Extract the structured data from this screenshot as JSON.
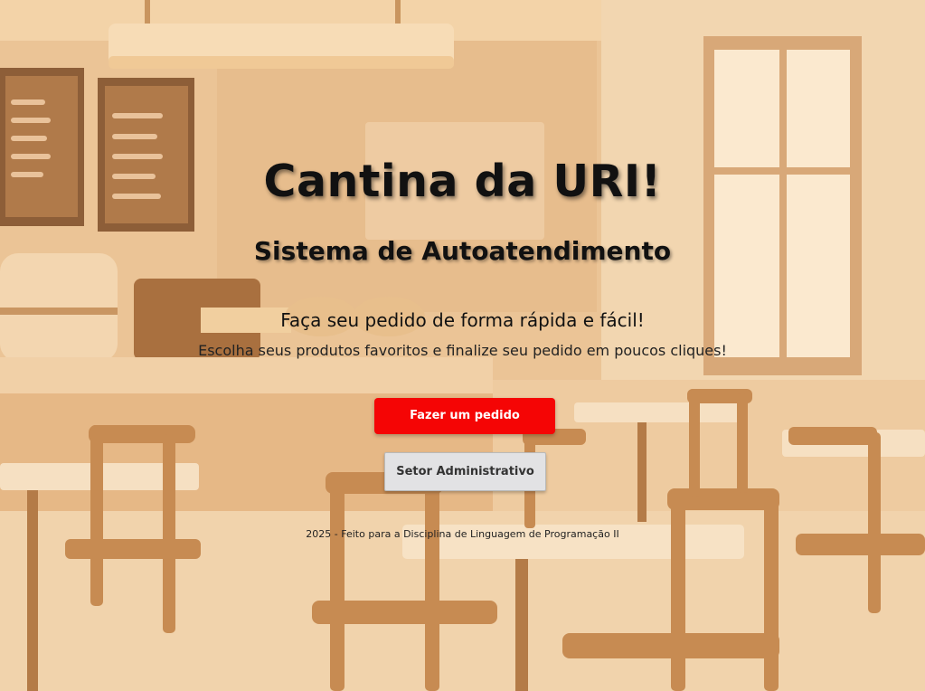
{
  "page": {
    "title": "Cantina da URI!",
    "subtitle": "Sistema de Autoatendimento",
    "tagline": "Faça seu pedido de forma rápida e fácil!",
    "description": "Escolha seus produtos favoritos e finalize seu pedido em poucos cliques!"
  },
  "actions": {
    "order_label": "Fazer um pedido",
    "admin_label": "Setor Administrativo"
  },
  "footer": {
    "text": "2025 - Feito para a Disciplina de Linguagem de Programação II"
  },
  "colors": {
    "primary_button": "#f50505",
    "secondary_button": "#e2e2e4",
    "background_tone": "#f3d7b2"
  },
  "icons": {
    "background": "cafeteria-interior-illustration"
  }
}
